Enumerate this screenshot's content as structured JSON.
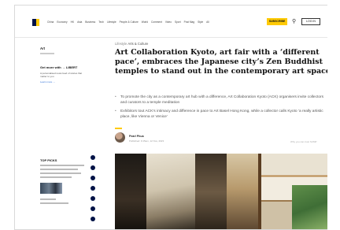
{
  "nav": {
    "links": [
      "China",
      "Economy",
      "HK",
      "Asia",
      "Business",
      "Tech",
      "Lifestyle",
      "People & Culture",
      "World",
      "Comment",
      "Video",
      "Sport",
      "Post Mag",
      "Style",
      "All"
    ],
    "subscribe_label": "SUBSCRIBE",
    "login_label": "LOG IN",
    "brand_colors": {
      "navy": "#001246",
      "yellow": "#ffca05"
    }
  },
  "sidebar": {
    "section_label": "Art",
    "promo_title": "Get more with → LIBERT",
    "promo_text": "A personalised news feed of stories that matter to you",
    "promo_link": "Learn more →"
  },
  "article": {
    "breadcrumb_section": "Lifestyle",
    "breadcrumb_sub": "Arts & Culture",
    "title": "Art Collaboration Kyoto, art fair with a ‘different pace’, embraces the Japanese city’s Zen Buddhist temples to stand out in the contemporary art space",
    "bullets": [
      "To promote the city as a contemporary art hub with a difference, Art Collaboration Kyoto (ACK) organisers invite collectors and curators to a temple meditation",
      "Exhibitors tout ACK’s intimacy and difference in pace to Art Basel Hong Kong, while a collector calls Kyoto ‘a really artistic place, like Vienna or Venice’"
    ],
    "author_name": "Pearl Phua",
    "author_date": "Published: 9:15am, 12 Nov, 2023",
    "share_info": "Why you can trust SCMP"
  },
  "top_picks": {
    "title": "TOP PICKS"
  },
  "social_icons": [
    "facebook-icon",
    "twitter-icon",
    "linkedin-icon",
    "whatsapp-icon",
    "telegram-icon",
    "email-icon",
    "link-icon"
  ]
}
